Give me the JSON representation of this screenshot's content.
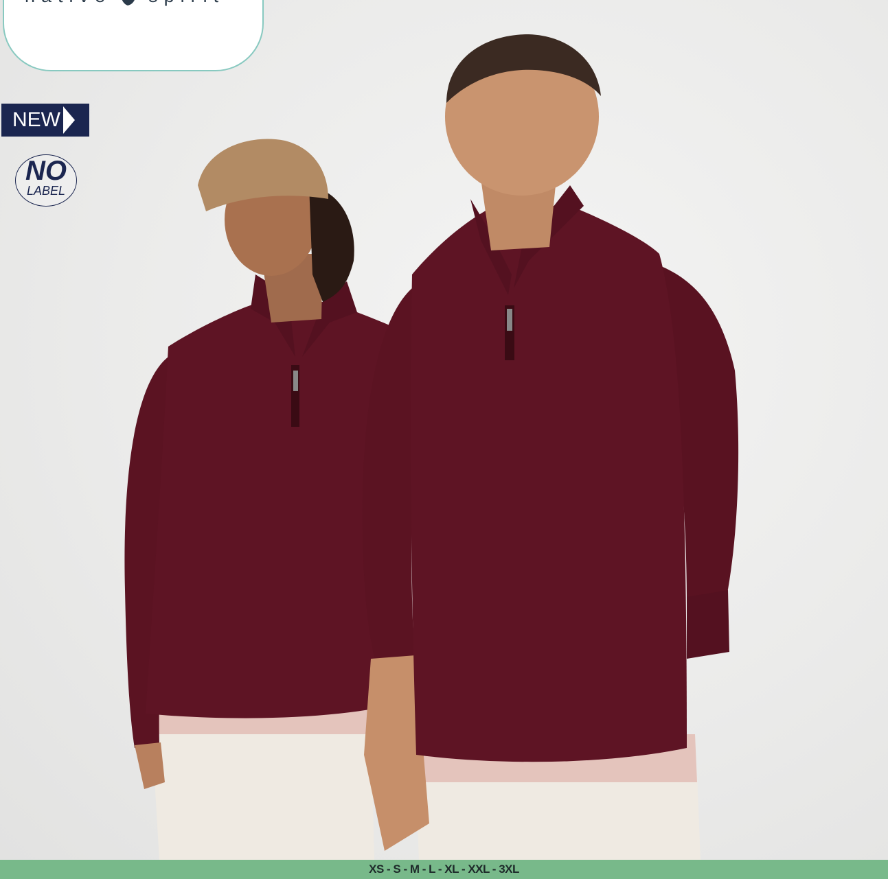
{
  "brand": {
    "word1": "native",
    "word2": "spirit",
    "logo_icon": "native-spirit-leaf-icon",
    "accent_color": "#88c9c0"
  },
  "badges": {
    "new_label": "NEW",
    "no_big": "NO",
    "no_small": "LABEL",
    "badge_color": "#1b2650"
  },
  "product": {
    "sweater_color": "#5e1424"
  },
  "sizes": {
    "label": "XS - S - M - L - XL - XXL - 3XL",
    "bar_color": "#78b98a"
  }
}
